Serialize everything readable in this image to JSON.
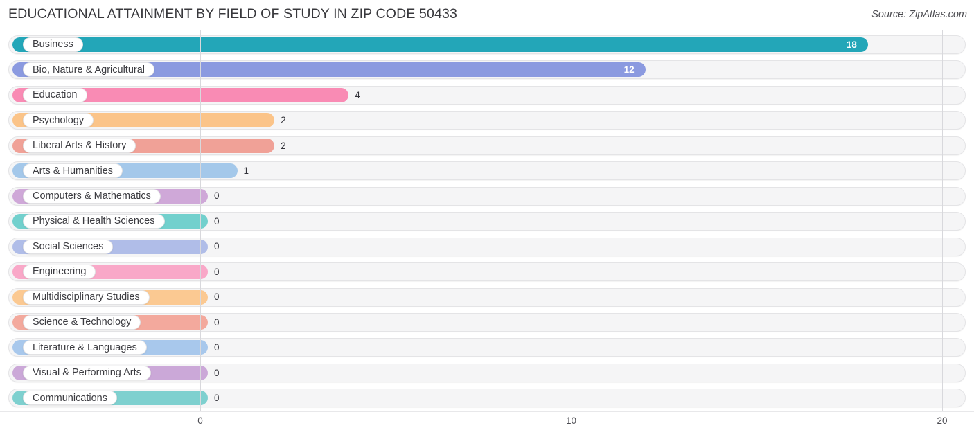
{
  "header": {
    "title": "EDUCATIONAL ATTAINMENT BY FIELD OF STUDY IN ZIP CODE 50433",
    "source": "Source: ZipAtlas.com"
  },
  "chart_data": {
    "type": "bar",
    "orientation": "horizontal",
    "title": "EDUCATIONAL ATTAINMENT BY FIELD OF STUDY IN ZIP CODE 50433",
    "xlabel": "",
    "ylabel": "",
    "xlim": [
      0,
      20
    ],
    "xticks": [
      0,
      10,
      20
    ],
    "xtick_labels": [
      "0",
      "10",
      "20"
    ],
    "grid": true,
    "legend": false,
    "categories": [
      "Business",
      "Bio, Nature & Agricultural",
      "Education",
      "Psychology",
      "Liberal Arts & History",
      "Arts & Humanities",
      "Computers & Mathematics",
      "Physical & Health Sciences",
      "Social Sciences",
      "Engineering",
      "Multidisciplinary Studies",
      "Science & Technology",
      "Literature & Languages",
      "Visual & Performing Arts",
      "Communications"
    ],
    "values": [
      18,
      12,
      4,
      2,
      2,
      1,
      0,
      0,
      0,
      0,
      0,
      0,
      0,
      0,
      0
    ],
    "value_labels": [
      "18",
      "12",
      "4",
      "2",
      "2",
      "1",
      "0",
      "0",
      "0",
      "0",
      "0",
      "0",
      "0",
      "0",
      "0"
    ],
    "colors": [
      "#23a6b8",
      "#8b9ae0",
      "#f98bb4",
      "#fbc489",
      "#f0a197",
      "#a4c8ea",
      "#cfa8d8",
      "#72d0cd",
      "#b0bde8",
      "#f9a8c8",
      "#fbc992",
      "#f3a99d",
      "#a8c8ec",
      "#cba8d8",
      "#7ed0cf"
    ]
  }
}
